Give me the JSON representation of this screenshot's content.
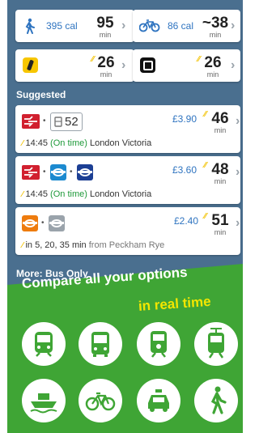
{
  "quick_options": [
    {
      "icon": "walk-icon",
      "calories": "395 cal",
      "minutes": "95",
      "unit": "min"
    },
    {
      "icon": "bicycle-icon",
      "calories": "86 cal",
      "minutes": "~38",
      "unit": "min"
    },
    {
      "icon": "taxi-app-icon",
      "minutes": "26",
      "unit": "min"
    },
    {
      "icon": "uber-icon",
      "minutes": "26",
      "unit": "min"
    }
  ],
  "suggested": {
    "title": "Suggested",
    "routes": [
      {
        "line": "52",
        "price": "£3.90",
        "minutes": "46",
        "unit": "min",
        "time": "14:45",
        "status": "(On time)",
        "destination": "London Victoria"
      },
      {
        "price": "£3.60",
        "minutes": "48",
        "unit": "min",
        "time": "14:45",
        "status": "(On time)",
        "destination": "London Victoria"
      },
      {
        "price": "£2.40",
        "minutes": "51",
        "unit": "min",
        "frequency": "in 5, 20, 35 min",
        "from_label": "from Peckham Rye"
      }
    ]
  },
  "more": {
    "title": "More: Bus Only"
  },
  "promo": {
    "line1": "Compare all your options",
    "line2": "in real time"
  },
  "mode_icons": [
    "train-icon",
    "bus-icon",
    "tram-icon",
    "light-rail-icon",
    "ferry-icon",
    "bike-icon",
    "taxi-icon",
    "walk-icon"
  ],
  "colors": {
    "accent": "#2f74c0",
    "on_time": "#1f9a3a",
    "realtime": "#f2c200",
    "promo_bg": "#3fa535",
    "promo_highlight": "#f2e600"
  }
}
